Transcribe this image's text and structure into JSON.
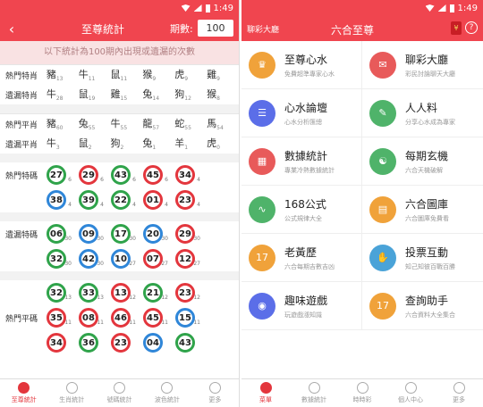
{
  "status": {
    "time": "1:49"
  },
  "left": {
    "back_icon": "‹",
    "title": "至尊統計",
    "period_label": "期數:",
    "period_value": "100",
    "notice": "以下統計為100期內出現或遺漏的次數",
    "zodiac_rows": [
      {
        "label": "熱門特肖",
        "cells": [
          [
            "豬",
            "13"
          ],
          [
            "牛",
            "11"
          ],
          [
            "鼠",
            "11"
          ],
          [
            "猴",
            "9"
          ],
          [
            "虎",
            "9"
          ],
          [
            "雞",
            "9"
          ]
        ]
      },
      {
        "label": "遺漏特肖",
        "cells": [
          [
            "牛",
            "28"
          ],
          [
            "鼠",
            "19"
          ],
          [
            "雞",
            "15"
          ],
          [
            "兔",
            "14"
          ],
          [
            "狗",
            "12"
          ],
          [
            "猴",
            "8"
          ]
        ]
      },
      {
        "label": "熱門平肖",
        "cells": [
          [
            "豬",
            "60"
          ],
          [
            "兔",
            "55"
          ],
          [
            "牛",
            "55"
          ],
          [
            "龍",
            "57"
          ],
          [
            "蛇",
            "55"
          ],
          [
            "馬",
            "54"
          ]
        ]
      },
      {
        "label": "遺漏平肖",
        "cells": [
          [
            "牛",
            "3"
          ],
          [
            "鼠",
            "2"
          ],
          [
            "狗",
            "2"
          ],
          [
            "兔",
            "1"
          ],
          [
            "羊",
            "1"
          ],
          [
            "虎",
            "0"
          ]
        ]
      }
    ],
    "ball_sections": [
      {
        "label": "熱門特碼",
        "rows": [
          [
            [
              "27",
              "6",
              "green"
            ],
            [
              "29",
              "6",
              "red"
            ],
            [
              "43",
              "6",
              "green"
            ],
            [
              "45",
              "6",
              "red"
            ],
            [
              "34",
              "4",
              "red"
            ]
          ],
          [
            [
              "38",
              "4",
              "blue"
            ],
            [
              "39",
              "4",
              "green"
            ],
            [
              "22",
              "4",
              "green"
            ],
            [
              "01",
              "4",
              "red"
            ],
            [
              "23",
              "4",
              "red"
            ]
          ]
        ]
      },
      {
        "label": "遺漏特碼",
        "rows": [
          [
            [
              "06",
              "30",
              "green"
            ],
            [
              "09",
              "30",
              "blue"
            ],
            [
              "17",
              "30",
              "green"
            ],
            [
              "20",
              "30",
              "blue"
            ],
            [
              "29",
              "30",
              "red"
            ]
          ],
          [
            [
              "32",
              "30",
              "green"
            ],
            [
              "42",
              "30",
              "blue"
            ],
            [
              "10",
              "27",
              "blue"
            ],
            [
              "07",
              "27",
              "red"
            ],
            [
              "12",
              "27",
              "red"
            ]
          ]
        ]
      },
      {
        "label": "熱門平碼",
        "rows": [
          [
            [
              "32",
              "13",
              "green"
            ],
            [
              "33",
              "13",
              "green"
            ],
            [
              "13",
              "12",
              "red"
            ],
            [
              "21",
              "12",
              "green"
            ],
            [
              "23",
              "12",
              "red"
            ]
          ],
          [
            [
              "35",
              "11",
              "red"
            ],
            [
              "08",
              "11",
              "red"
            ],
            [
              "46",
              "11",
              "red"
            ],
            [
              "45",
              "11",
              "red"
            ],
            [
              "15",
              "11",
              "blue"
            ]
          ],
          [
            [
              "34",
              "",
              "red"
            ],
            [
              "36",
              "",
              "green"
            ],
            [
              "23",
              "",
              "red"
            ],
            [
              "04",
              "",
              "blue"
            ],
            [
              "43",
              "",
              "green"
            ]
          ]
        ]
      }
    ],
    "tabs": [
      {
        "label": "至尊統計",
        "active": true
      },
      {
        "label": "生肖統計",
        "active": false
      },
      {
        "label": "號碼統計",
        "active": false
      },
      {
        "label": "波色統計",
        "active": false
      },
      {
        "label": "更多",
        "active": false
      }
    ]
  },
  "right": {
    "left_label": "聊彩大廳",
    "title": "六合至尊",
    "menu": [
      {
        "title": "至尊心水",
        "sub": "免費超準專家心水",
        "color": "#f0a23a",
        "icon": "trophy-icon",
        "glyph": "♛"
      },
      {
        "title": "聊彩大廳",
        "sub": "彩民討論聊天大廳",
        "color": "#e85a5a",
        "icon": "chat-icon",
        "glyph": "✉"
      },
      {
        "title": "心水論壇",
        "sub": "心水分析匯總",
        "color": "#5b6ee8",
        "icon": "forum-icon",
        "glyph": "☰"
      },
      {
        "title": "人人料",
        "sub": "分享心水成為專家",
        "color": "#4fb36a",
        "icon": "profile-icon",
        "glyph": "✎"
      },
      {
        "title": "數據統計",
        "sub": "專業冷熱數據統計",
        "color": "#e85a5a",
        "icon": "stats-icon",
        "glyph": "▦"
      },
      {
        "title": "每期玄機",
        "sub": "六合天機破解",
        "color": "#4fb36a",
        "icon": "book-icon",
        "glyph": "☯"
      },
      {
        "title": "168公式",
        "sub": "公式規律大全",
        "color": "#4fb36a",
        "icon": "formula-icon",
        "glyph": "∿"
      },
      {
        "title": "六合圖庫",
        "sub": "六合圖庫免費看",
        "color": "#f0a23a",
        "icon": "gallery-icon",
        "glyph": "▤"
      },
      {
        "title": "老黃歷",
        "sub": "六合每期吉數吉凶",
        "color": "#f0a23a",
        "icon": "calendar-icon",
        "glyph": "17"
      },
      {
        "title": "投票互動",
        "sub": "知己知彼百戰百勝",
        "color": "#4aa3d8",
        "icon": "vote-icon",
        "glyph": "✋"
      },
      {
        "title": "趣味遊戲",
        "sub": "玩遊戲漲知識",
        "color": "#5b6ee8",
        "icon": "game-icon",
        "glyph": "◉"
      },
      {
        "title": "查詢助手",
        "sub": "六合資料大全集合",
        "color": "#f0a23a",
        "icon": "search-helper-icon",
        "glyph": "17"
      }
    ],
    "tabs": [
      {
        "label": "菜單",
        "active": true
      },
      {
        "label": "數據統計",
        "active": false
      },
      {
        "label": "時時彩",
        "active": false
      },
      {
        "label": "個人中心",
        "active": false
      },
      {
        "label": "更多",
        "active": false
      }
    ]
  }
}
